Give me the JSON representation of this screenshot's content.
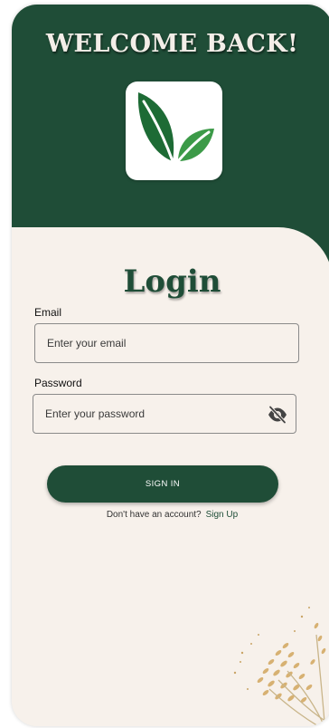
{
  "header": {
    "title": "WELCOME BACK!"
  },
  "login": {
    "title": "Login",
    "email": {
      "label": "Email",
      "placeholder": "Enter your email",
      "value": ""
    },
    "password": {
      "label": "Password",
      "placeholder": "Enter your password",
      "value": "",
      "toggle_icon": "eye-off-icon"
    },
    "signin_label": "SIGN IN",
    "signup_prompt": "Don't have an account?",
    "signup_link": "Sign Up"
  },
  "colors": {
    "primary": "#1f4d37",
    "background": "#f7f1eb",
    "leaf_dark": "#1d6b35",
    "leaf_light": "#3c9a48"
  }
}
